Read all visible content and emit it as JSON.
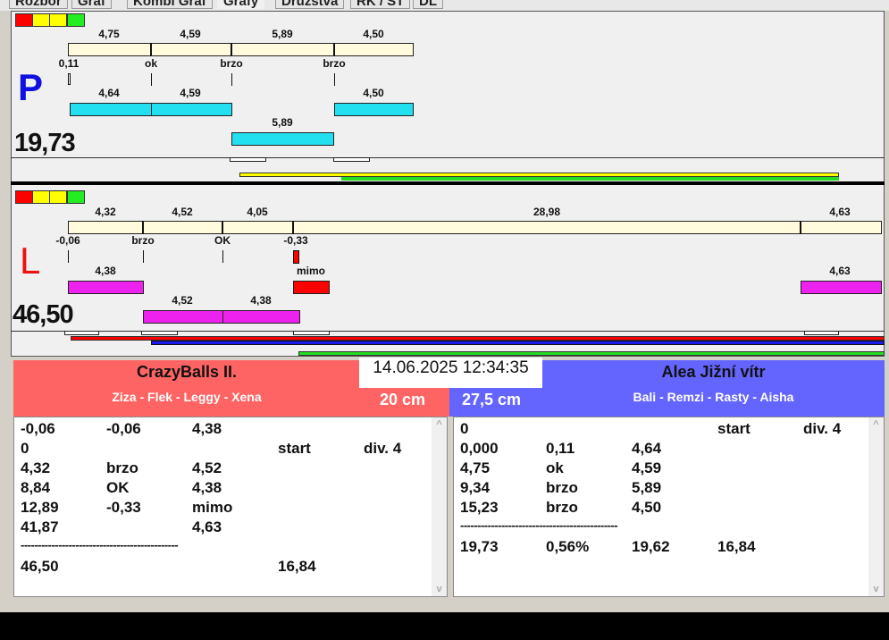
{
  "tabs": [
    "Rozbor",
    "Graf",
    "Kombi Graf",
    "Grafy",
    "Družstva",
    "RK / ST",
    "DL"
  ],
  "colors": {
    "red_team": "#ff6464",
    "blue_team": "#6464ff",
    "cyan": "#22e0f0",
    "magenta": "#ee22ee"
  },
  "top_panel": {
    "letter": "P",
    "total": "19,73",
    "row1": [
      "4,75",
      "4,59",
      "5,89",
      "4,50"
    ],
    "row2": [
      "0,11",
      "ok",
      "brzo",
      "brzo"
    ],
    "row3": [
      "4,64",
      "4,59",
      "4,50"
    ],
    "row4": [
      "5,89"
    ]
  },
  "bottom_panel": {
    "letter": "L",
    "total": "46,50",
    "row1": [
      "4,32",
      "4,52",
      "4,05",
      "28,98",
      "4,63"
    ],
    "row2": [
      "-0,06",
      "brzo",
      "OK",
      "-0,33"
    ],
    "row3": [
      "4,38",
      "mimo",
      "4,63"
    ],
    "row4": [
      "4,52",
      "4,38"
    ]
  },
  "datetime": "14.06.2025 12:34:35",
  "left_team": {
    "name": "CrazyBalls II.",
    "players": "Ziza - Flek - Leggy - Xena",
    "distance": "20 cm",
    "rows": [
      [
        "-0,06",
        "-0,06",
        "4,38",
        "",
        ""
      ],
      [
        "0",
        "",
        "",
        "start",
        "div. 4"
      ],
      [
        "4,32",
        "brzo",
        "4,52",
        "",
        ""
      ],
      [
        "8,84",
        "OK",
        "4,38",
        "",
        ""
      ],
      [
        "12,89",
        "-0,33",
        "mimo",
        "",
        ""
      ],
      [
        "41,87",
        "",
        "4,63",
        "",
        ""
      ],
      [
        "----------------------------------------------",
        "",
        "",
        "",
        ""
      ],
      [
        "46,50",
        "",
        "",
        "16,84",
        ""
      ]
    ]
  },
  "right_team": {
    "name": "Alea Jižní vítr",
    "players": "Bali - Remzi - Rasty - Aisha",
    "distance": "27,5 cm",
    "rows": [
      [
        "0",
        "",
        "",
        "start",
        "div. 4"
      ],
      [
        "0,000",
        "0,11",
        "4,64",
        "",
        ""
      ],
      [
        "4,75",
        "ok",
        "4,59",
        "",
        ""
      ],
      [
        "9,34",
        "brzo",
        "5,89",
        "",
        ""
      ],
      [
        "15,23",
        "brzo",
        "4,50",
        "",
        ""
      ],
      [
        "----------------------------------------------",
        "",
        "",
        "",
        ""
      ],
      [
        "19,73",
        "0,56%",
        "19,62",
        "16,84",
        ""
      ]
    ]
  }
}
